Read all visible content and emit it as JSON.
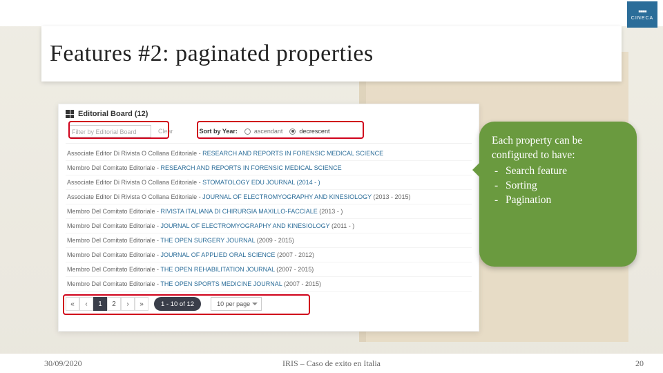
{
  "logo": "CINECA",
  "title": "Features #2: paginated properties",
  "panel": {
    "title": "Editorial Board (12)",
    "filter_placeholder": "Filter by Editorial Board",
    "clear": "Clear",
    "sort_label": "Sort by Year:",
    "asc": "ascendant",
    "desc": "decrescent",
    "rows": [
      {
        "role": "Associate Editor Di Rivista O Collana Editoriale",
        "journal": "RESEARCH AND REPORTS IN FORENSIC MEDICAL SCIENCE",
        "years": ""
      },
      {
        "role": "Membro Del Comitato Editoriale",
        "journal": "RESEARCH AND REPORTS IN FORENSIC MEDICAL SCIENCE",
        "years": ""
      },
      {
        "role": "Associate Editor Di Rivista O Collana Editoriale",
        "journal": "STOMATOLOGY EDU JOURNAL (2014 - )",
        "years": ""
      },
      {
        "role": "Associate Editor Di Rivista O Collana Editoriale",
        "journal": "JOURNAL OF ELECTROMYOGRAPHY AND KINESIOLOGY",
        "years": "(2013 - 2015)"
      },
      {
        "role": "Membro Del Comitato Editoriale",
        "journal": "RIVISTA ITALIANA DI CHIRURGIA MAXILLO-FACCIALE",
        "years": "(2013 - )"
      },
      {
        "role": "Membro Del Comitato Editoriale",
        "journal": "JOURNAL OF ELECTROMYOGRAPHY AND KINESIOLOGY",
        "years": "(2011 - )"
      },
      {
        "role": "Membro Del Comitato Editoriale",
        "journal": "THE OPEN SURGERY JOURNAL",
        "years": "(2009 - 2015)"
      },
      {
        "role": "Membro Del Comitato Editoriale",
        "journal": "JOURNAL OF APPLIED ORAL SCIENCE",
        "years": "(2007 - 2012)"
      },
      {
        "role": "Membro Del Comitato Editoriale",
        "journal": "THE OPEN REHABILITATION JOURNAL",
        "years": "(2007 - 2015)"
      },
      {
        "role": "Membro Del Comitato Editoriale",
        "journal": "THE OPEN SPORTS MEDICINE JOURNAL",
        "years": "(2007 - 2015)"
      }
    ],
    "pager": {
      "first": "«",
      "prev": "‹",
      "p1": "1",
      "p2": "2",
      "next": "›",
      "last": "»",
      "range": "1 - 10 of 12",
      "perpage": "10 per page"
    }
  },
  "callout": {
    "lead": "Each property can be configured to have:",
    "items": [
      "Search feature",
      "Sorting",
      "Pagination"
    ]
  },
  "footer": {
    "date": "30/09/2020",
    "caption": "IRIS – Caso de exito en Italia",
    "page": "20"
  }
}
